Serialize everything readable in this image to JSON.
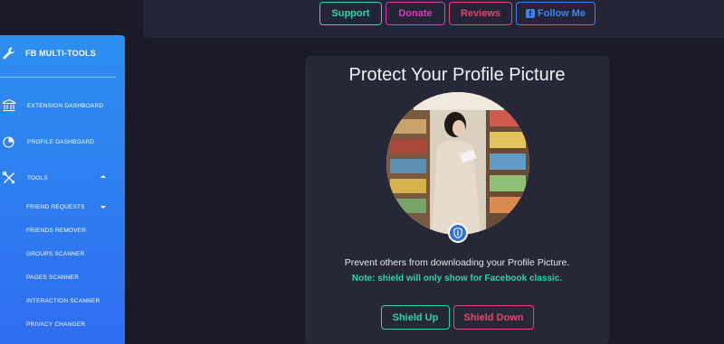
{
  "topbar": {
    "support_label": "Support",
    "donate_label": "Donate",
    "reviews_label": "Reviews",
    "follow_label": "Follow Me",
    "follow_icon": "facebook-icon"
  },
  "sidebar": {
    "brand": "FB MULTI-TOOLS",
    "brand_icon": "wrench-icon",
    "items": [
      {
        "label": "EXTENSION DASHBOARD",
        "icon": "bank-icon"
      },
      {
        "label": "PROFILE DASHBOARD",
        "icon": "pie-chart-icon"
      },
      {
        "label": "TOOLS",
        "icon": "tools-icon"
      }
    ],
    "sub_items": [
      {
        "label": "FRIEND REQUESTS"
      },
      {
        "label": "FRIENDS REMOVER"
      },
      {
        "label": "GROUPS SCANNER"
      },
      {
        "label": "PAGES SCANNER"
      },
      {
        "label": "INTERACTION SCANNER"
      },
      {
        "label": "PRIVACY CHANGER"
      }
    ]
  },
  "main": {
    "title": "Protect Your Profile Picture",
    "description": "Prevent others from downloading your Profile Picture.",
    "note": "Note: shield will only show for Facebook classic.",
    "shield_up_label": "Shield Up",
    "shield_down_label": "Shield Down",
    "shield_icon": "shield-icon"
  },
  "colors": {
    "accent_green": "#2ed3a6",
    "accent_pink": "#d63fb4",
    "accent_red": "#e3466b",
    "accent_blue": "#3b82f6",
    "sidebar_blue": "#2f80f0",
    "background": "#1a1b26",
    "card": "#262838"
  }
}
